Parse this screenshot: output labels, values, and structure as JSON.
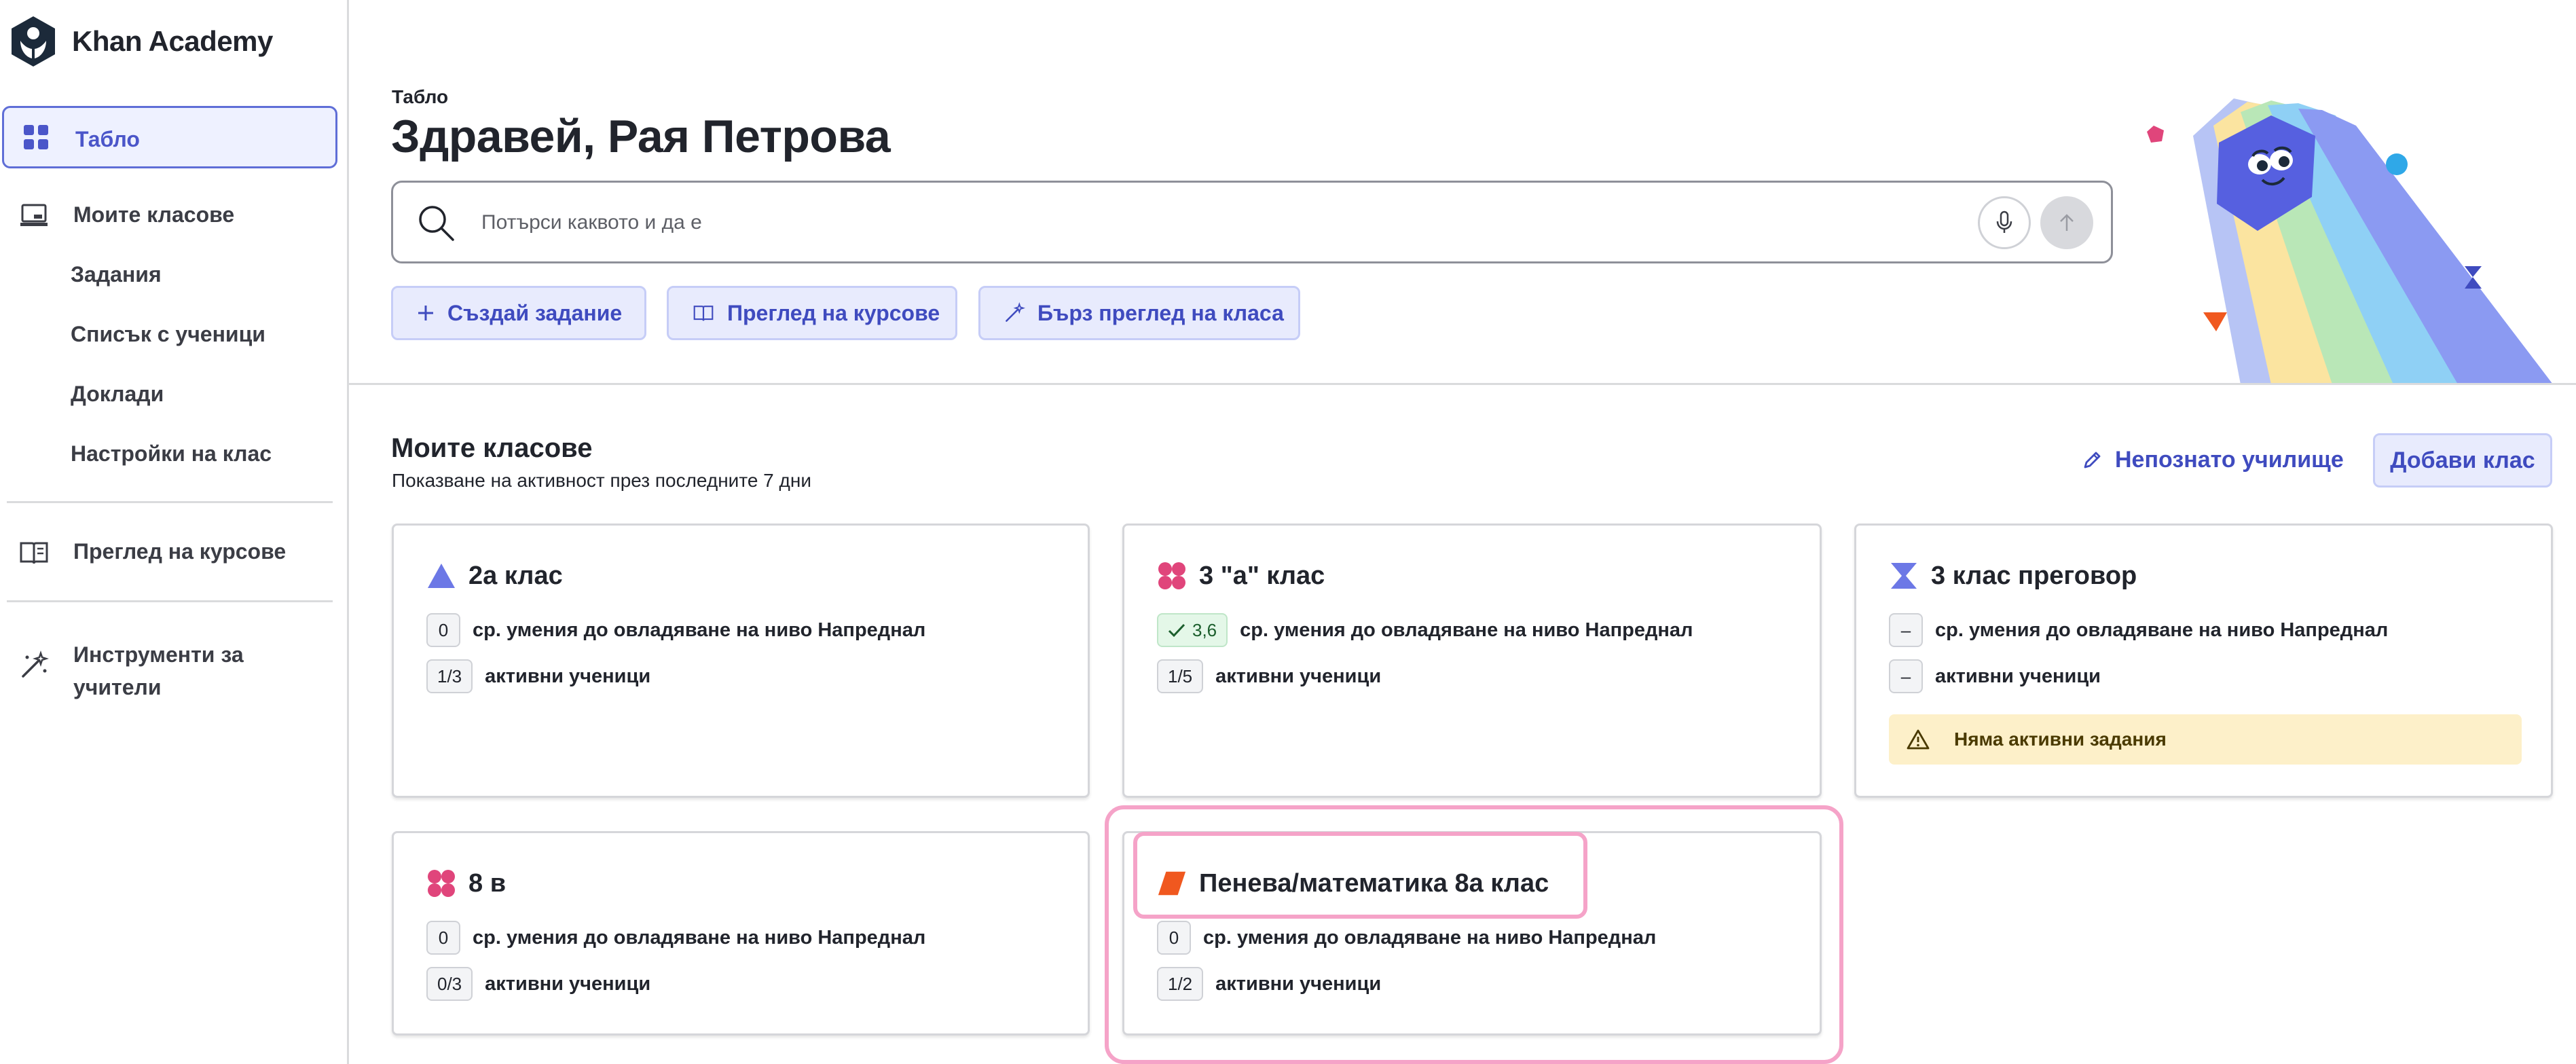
{
  "app": {
    "name": "Khan Academy"
  },
  "sidebar": {
    "dashboard_label": "Табло",
    "my_classes_label": "Моите класове",
    "sub_items": [
      "Задания",
      "Списък с ученици",
      "Доклади",
      "Настройки на клас"
    ],
    "course_overview_label": "Преглед на курсове",
    "teacher_tools_line1": "Инструменти за",
    "teacher_tools_line2": "учители"
  },
  "header": {
    "page_label": "Табло",
    "greeting": "Здравей, Рая Петрова",
    "search_placeholder": "Потърси каквото и да е",
    "actions": {
      "create_assignment": "Създай задание",
      "course_overview": "Преглед на курсове",
      "quick_class_review": "Бърз преглед на класа"
    }
  },
  "classes_section": {
    "title": "Моите класове",
    "subtitle": "Показване на активност през последните 7 дни",
    "unknown_school": "Непознато училище",
    "add_class": "Добави клас"
  },
  "classes": [
    {
      "name": "2а клас",
      "icon": "triangle-icon",
      "icon_color": "#6c78e6",
      "mastery": "0",
      "mastery_label": "ср. умения до овладяване на ниво Напреднал",
      "active": "1/3",
      "active_label": "активни ученици"
    },
    {
      "name": "3 \"а\" клас",
      "icon": "flower-icon",
      "icon_color": "#e0457b",
      "mastery": "3,6",
      "mastery_label": "ср. умения до овладяване на ниво Напреднал",
      "active": "1/5",
      "active_label": "активни ученици"
    },
    {
      "name": "3 клас преговор",
      "icon": "hourglass-icon",
      "icon_color": "#6c78e6",
      "mastery": "–",
      "mastery_label": "ср. умения до овладяване на ниво Напреднал",
      "active": "–",
      "active_label": "активни ученици",
      "warning": "Няма активни задания"
    },
    {
      "name": "8 в",
      "icon": "flower-icon",
      "icon_color": "#e0457b",
      "mastery": "0",
      "mastery_label": "ср. умения до овладяване на ниво Напреднал",
      "active": "0/3",
      "active_label": "активни ученици"
    },
    {
      "name": "Пенева/математика 8а клас",
      "icon": "parallelogram-icon",
      "icon_color": "#f0581f",
      "mastery": "0",
      "mastery_label": "ср. умения до овладяване на ниво Напреднал",
      "active": "1/2",
      "active_label": "активни ученици"
    }
  ],
  "colors": {
    "accent": "#3f4bbf",
    "active_nav_bg": "#eef1ff",
    "highlight": "#f5a3c8",
    "warning_bg": "#fdf0c9"
  }
}
